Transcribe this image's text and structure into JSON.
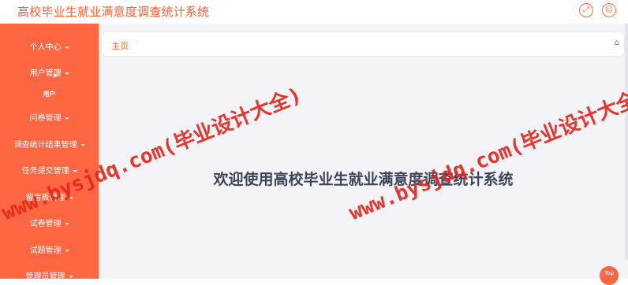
{
  "app": {
    "title": "高校毕业生就业满意度调查统计系统"
  },
  "header": {
    "icons": [
      "fullscreen-icon",
      "user-icon"
    ]
  },
  "sidebar": {
    "items": [
      {
        "label": "个人中心"
      },
      {
        "label": "用户管理"
      },
      {
        "label": "用户"
      },
      {
        "label": "问卷管理"
      },
      {
        "label": "调查统计结果管理"
      },
      {
        "label": "任务提交管理"
      },
      {
        "label": "留言板管理"
      },
      {
        "label": "试卷管理"
      },
      {
        "label": "试题管理"
      },
      {
        "label": "管理员管理"
      }
    ]
  },
  "breadcrumb": {
    "label": "主页"
  },
  "main": {
    "welcome": "欢迎使用高校毕业生就业满意度调查统计系统"
  },
  "watermark": {
    "text": "www.bysjdq.com(毕业设计大全)"
  },
  "back_to_top": {
    "label": "Top"
  },
  "colors": {
    "accent": "#ff6742",
    "title": "#ff5f2f",
    "watermark": "#e8241a",
    "welcome_text": "#3d4458"
  }
}
